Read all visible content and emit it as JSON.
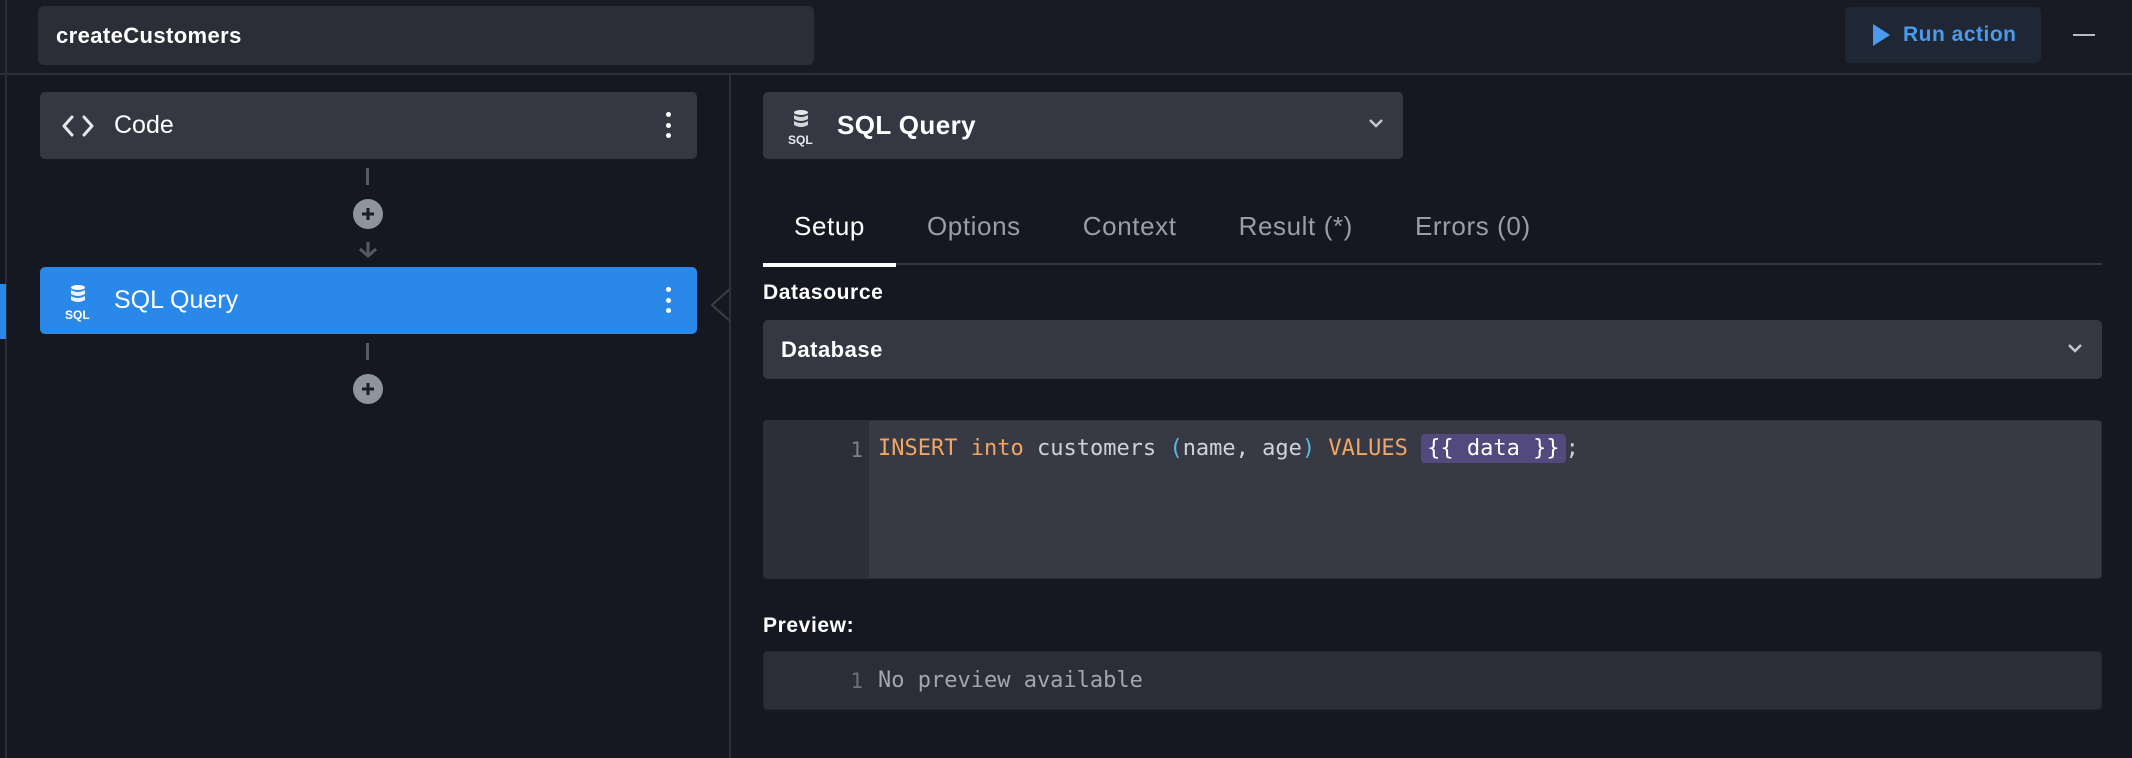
{
  "header": {
    "action_name": "createCustomers",
    "run_label": "Run action"
  },
  "steps": [
    {
      "label": "Code",
      "icon": "code-icon"
    },
    {
      "label": "SQL Query",
      "icon": "sql-icon",
      "icon_text": "SQL",
      "selected": true
    }
  ],
  "editor": {
    "step_type": "SQL Query",
    "step_type_icon_text": "SQL",
    "tabs": [
      "Setup",
      "Options",
      "Context",
      "Result (*)",
      "Errors (0)"
    ],
    "active_tab": "Setup",
    "datasource_label": "Datasource",
    "datasource_value": "Database",
    "code": {
      "line_number": "1",
      "tokens": {
        "insert": "INSERT",
        "into": "into",
        "table": "customers",
        "open_paren": "(",
        "columns": "name, age",
        "close_paren": ")",
        "values": "VALUES",
        "template": "{{ data }}",
        "semicolon": ";"
      }
    },
    "preview_label": "Preview:",
    "preview": {
      "line_number": "1",
      "text": "No preview available"
    }
  },
  "colors": {
    "background": "#161821",
    "accent": "#2a88e9",
    "card": "#353842",
    "keyword": "#f2a662",
    "template_bg": "#524a7c"
  }
}
